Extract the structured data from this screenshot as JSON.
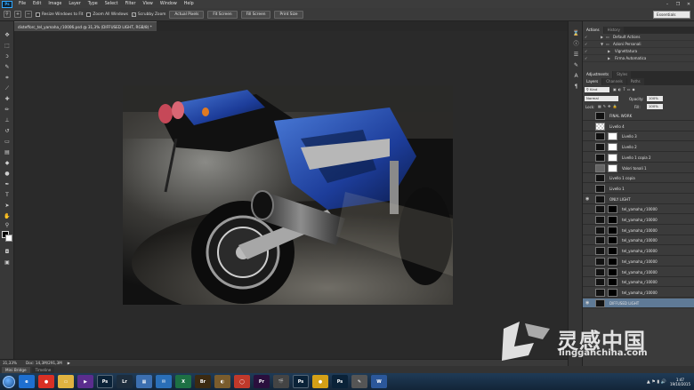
{
  "menubar": {
    "app_logo": "Ps",
    "items": [
      "File",
      "Edit",
      "Image",
      "Layer",
      "Type",
      "Select",
      "Filter",
      "View",
      "Window",
      "Help"
    ]
  },
  "options_bar": {
    "checks": [
      {
        "label": "Resize Windows to Fit",
        "checked": false
      },
      {
        "label": "Zoom All Windows",
        "checked": false
      },
      {
        "label": "Scrubby Zoom",
        "checked": true
      }
    ],
    "buttons": [
      "Actual Pixels",
      "Fit Screen",
      "Fill Screen",
      "Print Size"
    ],
    "workspace": "Essentials"
  },
  "document": {
    "tab_title": "distefforc_tel_yamaha_r10006.psd @ 31,3% (DIFFUSED LIGHT, RGB/8) *"
  },
  "status": {
    "zoom": "31,33%",
    "doc_info": "Doc: 14,3M/291,3M"
  },
  "bottom_tabs": [
    "Mini Bridge",
    "Timeline"
  ],
  "actions_panel": {
    "tabs": [
      "Actions",
      "History"
    ],
    "rows": [
      {
        "label": "Default Actions",
        "level": 0,
        "folder": true
      },
      {
        "label": "Azioni Personali",
        "level": 0,
        "folder": true
      },
      {
        "label": "Vignettatura",
        "level": 1,
        "folder": false
      },
      {
        "label": "Firma Automatica",
        "level": 1,
        "folder": false
      }
    ]
  },
  "adjustments_panel": {
    "tabs": [
      "Adjustments",
      "Styles"
    ]
  },
  "layers_panel": {
    "tabs": [
      "Layers",
      "Channels",
      "Paths"
    ],
    "filter_kind": "Kind",
    "blend_mode": "Normal",
    "opacity_label": "Opacity:",
    "opacity_value": "100%",
    "lock_label": "Lock:",
    "fill_label": "Fill:",
    "fill_value": "100%",
    "layers": [
      {
        "name": "FINAL WORK",
        "type": "thumb",
        "visible": false,
        "selected": false
      },
      {
        "name": "Livello 4",
        "type": "checker",
        "visible": false,
        "selected": false
      },
      {
        "name": "Livello 3",
        "type": "thumb-mask",
        "visible": false,
        "selected": false
      },
      {
        "name": "Livello 2",
        "type": "thumb-mask",
        "visible": false,
        "selected": false
      },
      {
        "name": "Livello 1 copia 2",
        "type": "thumb-mask",
        "visible": false,
        "selected": false
      },
      {
        "name": "Valori tonali 1",
        "type": "adjust-mask",
        "visible": false,
        "selected": false
      },
      {
        "name": "Livello 1 copia",
        "type": "thumb",
        "visible": false,
        "selected": false
      },
      {
        "name": "Livello 1",
        "type": "thumb",
        "visible": false,
        "selected": false
      },
      {
        "name": "ONLY LIGHT",
        "type": "thumb",
        "visible": true,
        "selected": false
      },
      {
        "name": "tel_yamaha_r10000",
        "type": "thumb-mask",
        "visible": false,
        "selected": false
      },
      {
        "name": "tel_yamaha_r10000",
        "type": "thumb-mask",
        "visible": false,
        "selected": false
      },
      {
        "name": "tel_yamaha_r10000",
        "type": "thumb-mask",
        "visible": false,
        "selected": false
      },
      {
        "name": "tel_yamaha_r10000",
        "type": "thumb-mask",
        "visible": false,
        "selected": false
      },
      {
        "name": "tel_yamaha_r10000",
        "type": "thumb-mask",
        "visible": false,
        "selected": false
      },
      {
        "name": "tel_yamaha_r10000",
        "type": "thumb-mask",
        "visible": false,
        "selected": false
      },
      {
        "name": "tel_yamaha_r10000",
        "type": "thumb-mask",
        "visible": false,
        "selected": false
      },
      {
        "name": "tel_yamaha_r10000",
        "type": "thumb-mask",
        "visible": false,
        "selected": false
      },
      {
        "name": "tel_yamaha_r10000",
        "type": "thumb-mask",
        "visible": false,
        "selected": false
      },
      {
        "name": "DIFFUSED LIGHT",
        "type": "thumb",
        "visible": true,
        "selected": true
      }
    ]
  },
  "watermark": {
    "chinese": "灵感中国",
    "url": "lingganchina.com"
  },
  "taskbar": {
    "apps": [
      {
        "label": "e",
        "color": "#1e6fd0"
      },
      {
        "label": "●",
        "color": "#d93025"
      },
      {
        "label": "▭",
        "color": "#e0b341"
      },
      {
        "label": "▶",
        "color": "#5b2d8e"
      },
      {
        "label": "Ps",
        "color": "#0a2238"
      },
      {
        "label": "Lr",
        "color": "#1d2d3d"
      },
      {
        "label": "▦",
        "color": "#3c6fb0"
      },
      {
        "label": "✉",
        "color": "#2a6fb8"
      },
      {
        "label": "X",
        "color": "#1d7044"
      },
      {
        "label": "Br",
        "color": "#3b2a12"
      },
      {
        "label": "◐",
        "color": "#7a5c2d"
      },
      {
        "label": "◯",
        "color": "#c0392b"
      },
      {
        "label": "Pr",
        "color": "#2a0f3d"
      },
      {
        "label": "🎬",
        "color": "#444"
      },
      {
        "label": "Ps",
        "color": "#0a2238"
      },
      {
        "label": "●",
        "color": "#d4a017"
      },
      {
        "label": "Ps",
        "color": "#0a2238"
      },
      {
        "label": "✎",
        "color": "#555"
      },
      {
        "label": "W",
        "color": "#2b579a"
      }
    ],
    "time": "1:47",
    "date": "19/10/2015"
  }
}
